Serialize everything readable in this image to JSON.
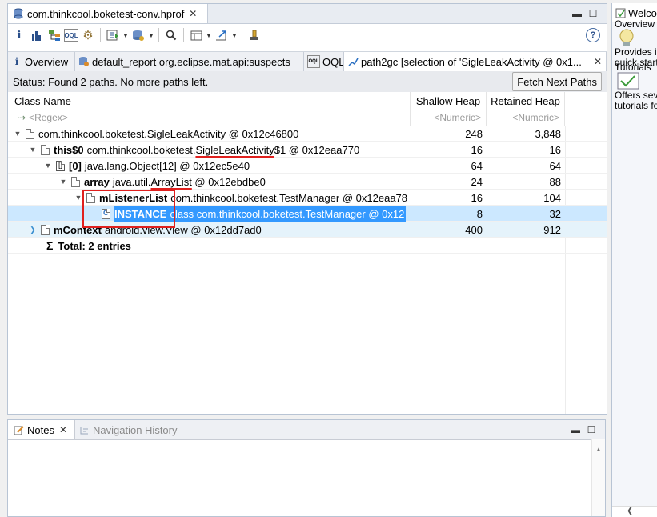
{
  "editor": {
    "tab_title": "com.thinkcool.boketest-conv.hprof",
    "tab_icon": "heap-dump-icon"
  },
  "toolbar": {
    "buttons": [
      "info-icon",
      "histogram-icon",
      "dominator-tree-icon",
      "oql-icon",
      "settings-gear-icon",
      "run-report-icon",
      "query-browser-icon",
      "search-icon",
      "group-icon",
      "export-icon",
      "inspector-icon"
    ],
    "help_label": "?"
  },
  "subtabs": [
    {
      "label": "Overview",
      "icon": "info-icon"
    },
    {
      "label": "default_report  org.eclipse.mat.api:suspects",
      "icon": "report-icon"
    },
    {
      "label": "OQL",
      "icon": "oql-icon"
    },
    {
      "label": "path2gc [selection of 'SigleLeakActivity @ 0x1...",
      "icon": "path-icon"
    }
  ],
  "status": {
    "text": "Status:  Found 2 paths. No more paths left.",
    "fetch_label": "Fetch Next Paths"
  },
  "table": {
    "columns": [
      "Class Name",
      "Shallow Heap",
      "Retained Heap"
    ],
    "filters": [
      "<Regex>",
      "<Numeric>",
      "<Numeric>"
    ],
    "rows": [
      {
        "field": "",
        "name_pre": "com.thinkcool.boketest.SigleLeakActivity @ 0x12c46800",
        "name_ul": "",
        "name_post": "",
        "shallow": "248",
        "retained": "3,848"
      },
      {
        "field": "this$0",
        "name_pre": "com.thinkcool.boketest.",
        "name_ul": "SigleLeakActivity",
        "name_post": "$1 @ 0x12eaa770",
        "shallow": "16",
        "retained": "16"
      },
      {
        "field": "[0]",
        "name_pre": "java.lang.Object[12] @ 0x12ec5e40",
        "name_ul": "",
        "name_post": "",
        "shallow": "64",
        "retained": "64"
      },
      {
        "field": "array",
        "name_pre": "java.util.",
        "name_ul": "ArrayList",
        "name_post": " @ 0x12ebdbe0",
        "shallow": "24",
        "retained": "88"
      },
      {
        "field": "mListenerList",
        "name_pre": "com.thinkcool.boketest.TestManager @ 0x12eaa78",
        "name_ul": "",
        "name_post": "",
        "shallow": "16",
        "retained": "104"
      },
      {
        "field": "INSTANCE",
        "name_pre": "class com.thinkcool.boketest.TestManager @ 0x12",
        "name_ul": "",
        "name_post": "",
        "shallow": "8",
        "retained": "32"
      },
      {
        "field": "mContext",
        "name_pre": "android.view.View @ 0x12dd7ad0",
        "name_ul": "",
        "name_post": "",
        "shallow": "400",
        "retained": "912"
      }
    ],
    "total_symbol": "Σ",
    "total_label": "Total: 2 entries"
  },
  "notes": {
    "tab_label": "Notes",
    "nav_label": "Navigation History"
  },
  "welcome": {
    "tab_label": "Welcome",
    "lines": [
      "Overview",
      "Provides in",
      "quick start",
      "Tutorials",
      "Offers sev",
      "tutorials fo"
    ]
  },
  "colors": {
    "selection": "#3399ff",
    "selected_row": "#cce8ff",
    "annotation_red": "#e0201e"
  }
}
